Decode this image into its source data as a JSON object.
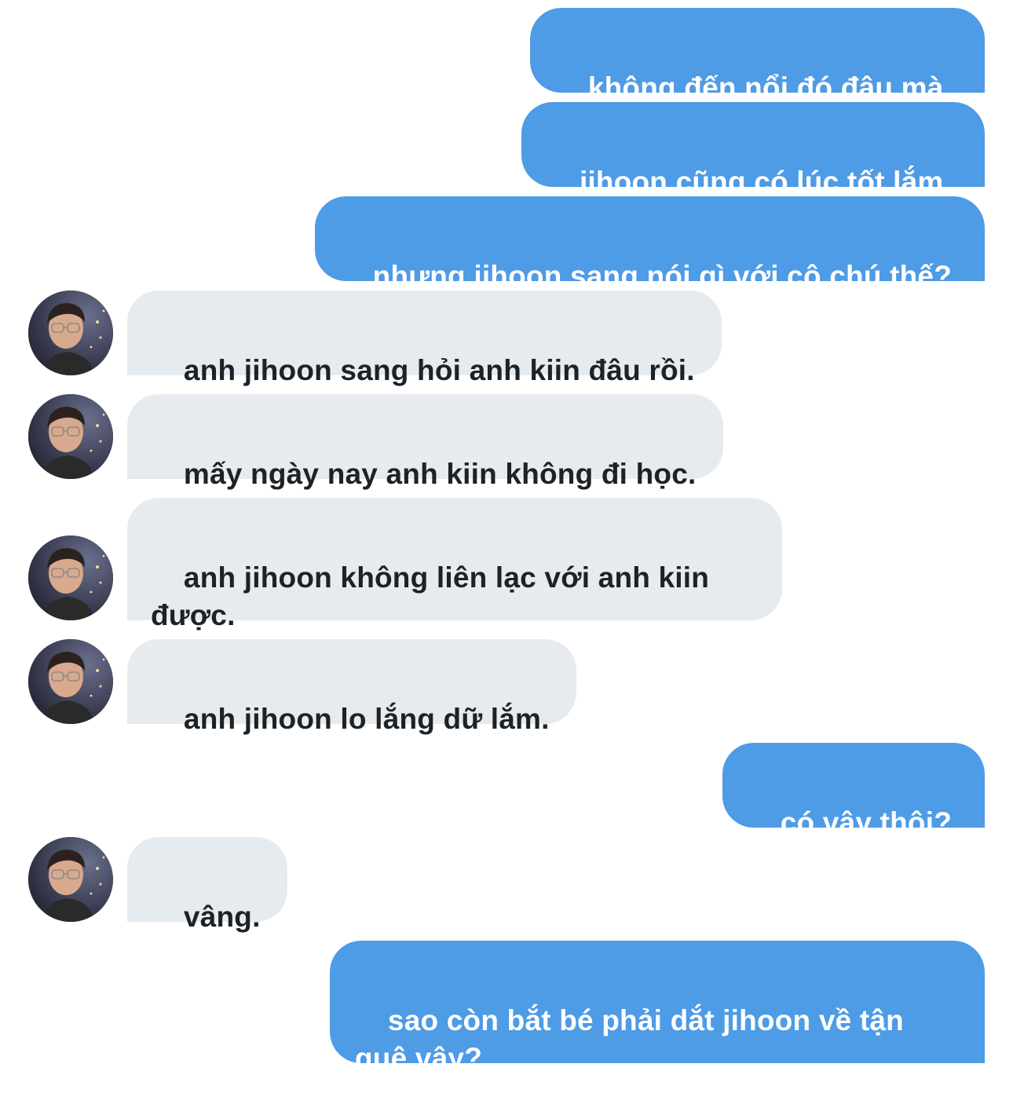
{
  "conversation": {
    "messages": [
      {
        "direction": "outgoing",
        "text": "không đến nổi đó đâu mà."
      },
      {
        "direction": "outgoing",
        "text": "jihoon cũng có lúc tốt lắm."
      },
      {
        "direction": "outgoing",
        "text": "nhưng jihoon sang nói gì với cô chú thế?"
      },
      {
        "direction": "incoming",
        "text": "anh jihoon sang hỏi anh kiin đâu rồi."
      },
      {
        "direction": "incoming",
        "text": "mấy ngày nay anh kiin không đi học."
      },
      {
        "direction": "incoming",
        "text": "anh jihoon không liên lạc với anh kiin\nđược."
      },
      {
        "direction": "incoming",
        "text": "anh jihoon lo lắng dữ lắm."
      },
      {
        "direction": "outgoing",
        "text": "có vậy thôi?"
      },
      {
        "direction": "incoming",
        "text": "vâng."
      },
      {
        "direction": "outgoing",
        "text": "sao còn bắt bé phải dắt jihoon về tận\nquê vậy?"
      }
    ]
  },
  "colors": {
    "outgoing_bubble": "#4e9be6",
    "outgoing_text": "#ffffff",
    "incoming_bubble": "#e6ebf0",
    "incoming_text": "#1d2226",
    "background": "#ffffff"
  }
}
